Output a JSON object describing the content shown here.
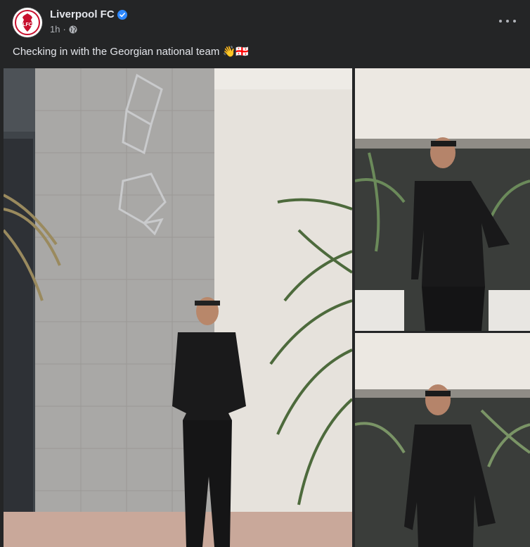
{
  "post": {
    "author": "Liverpool FC",
    "time": "1h",
    "separator": "·",
    "caption": "Checking in with the Georgian national team 👋🇬🇪"
  },
  "icons": {
    "avatar": "liverpool-crest",
    "verified": "verified-badge-icon",
    "audience": "globe-icon",
    "more": "more-options-icon"
  },
  "colors": {
    "background": "#242526",
    "verified": "#2d88ff",
    "brand": "#c8102e"
  },
  "avatar_logo_text": "LFC",
  "photos": [
    {
      "name": "photo-player-walking"
    },
    {
      "name": "photo-player-peace-sign"
    },
    {
      "name": "photo-player-smiling"
    }
  ]
}
